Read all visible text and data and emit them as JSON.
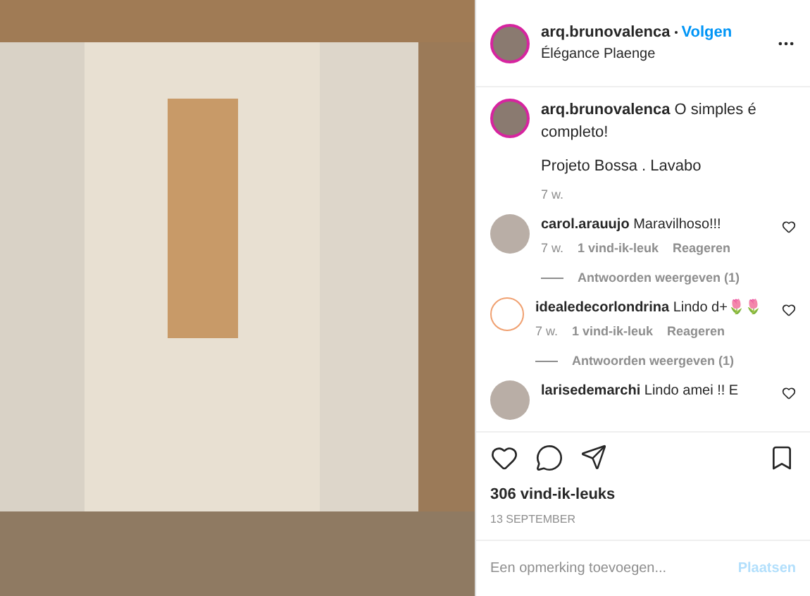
{
  "header": {
    "username": "arq.brunovalenca",
    "follow": "Volgen",
    "location": "Élégance Plaenge"
  },
  "caption": {
    "username": "arq.brunovalenca",
    "text": "O simples é completo!",
    "line2": "Projeto Bossa . Lavabo",
    "time": "7 w."
  },
  "comments": [
    {
      "username": "carol.arauujo",
      "text": "Maravilhoso!!!",
      "time": "7 w.",
      "likes": "1 vind-ik-leuk",
      "reply": "Reageren",
      "replies": "Antwoorden weergeven (1)",
      "kind": "photo"
    },
    {
      "username": "idealedecorlondrina",
      "text": "Lindo d+🌷🌷",
      "time": "7 w.",
      "likes": "1 vind-ik-leuk",
      "reply": "Reageren",
      "replies": "Antwoorden weergeven (1)",
      "kind": "logo"
    },
    {
      "username": "larisedemarchi",
      "text": "Lindo amei !! E",
      "kind": "photo"
    }
  ],
  "likes": "306 vind-ik-leuks",
  "date": "13 SEPTEMBER",
  "comment_input": {
    "placeholder": "Een opmerking toevoegen...",
    "submit": "Plaatsen"
  }
}
